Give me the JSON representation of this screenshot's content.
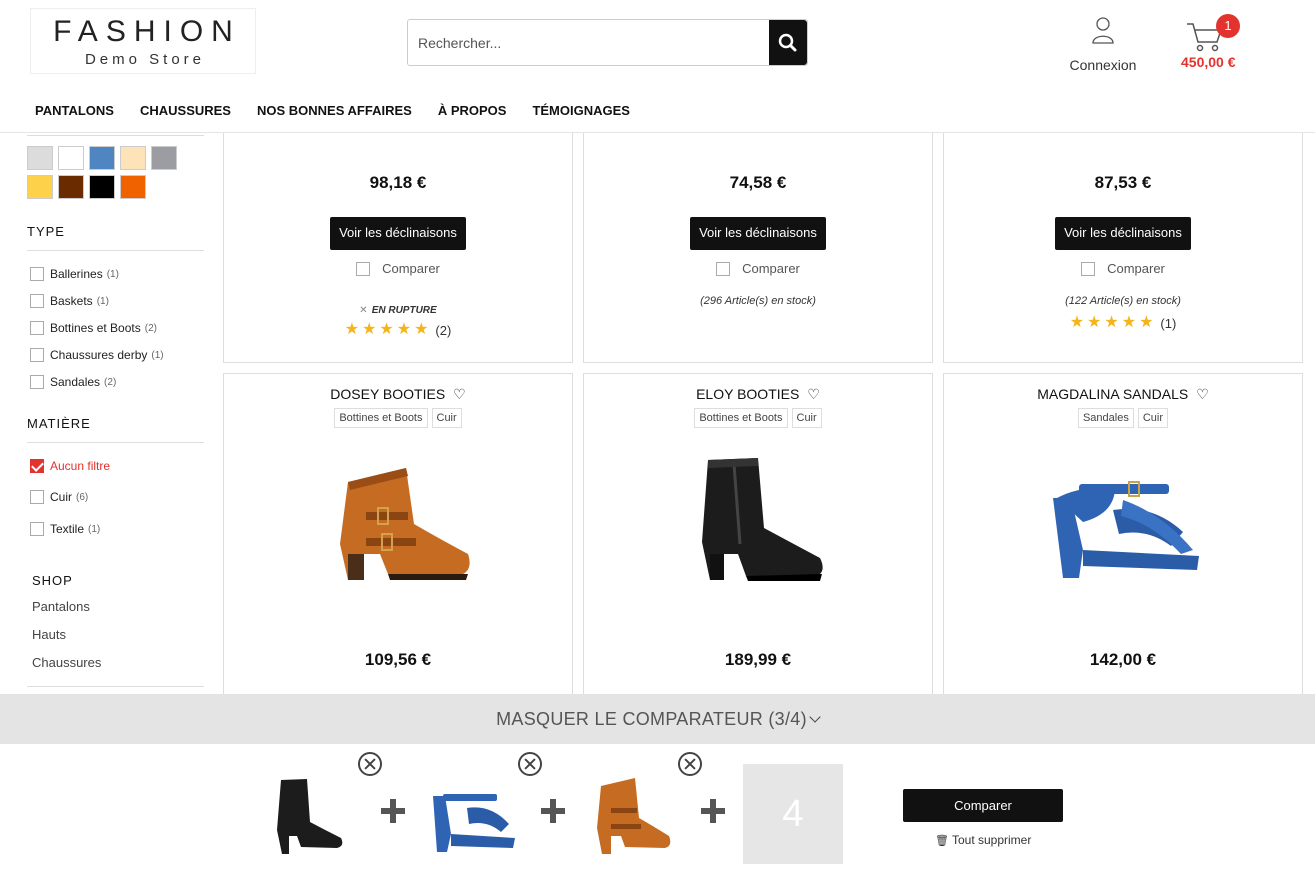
{
  "header": {
    "logo_main": "FASHION",
    "logo_sub": "Demo Store",
    "search_placeholder": "Rechercher...",
    "account_label": "Connexion",
    "cart_count": "1",
    "cart_total": "450,00 €"
  },
  "nav": [
    "PANTALONS",
    "CHAUSSURES",
    "NOS BONNES AFFAIRES",
    "À PROPOS",
    "TÉMOIGNAGES"
  ],
  "sidebar": {
    "colors": [
      "#dcdcdc",
      "#ffffff",
      "#4f86c1",
      "#fde3b7",
      "#9c9ca3",
      "#fdd14a",
      "#6b2b00",
      "#000000",
      "#f06200"
    ],
    "type_title": "TYPE",
    "types": [
      {
        "label": "Ballerines",
        "count": "(1)"
      },
      {
        "label": "Baskets",
        "count": "(1)"
      },
      {
        "label": "Bottines et Boots",
        "count": "(2)"
      },
      {
        "label": "Chaussures derby",
        "count": "(1)"
      },
      {
        "label": "Sandales",
        "count": "(2)"
      }
    ],
    "material_title": "MATIÈRE",
    "materials": [
      {
        "label": "Aucun filtre",
        "count": ""
      },
      {
        "label": "Cuir",
        "count": "(6)"
      },
      {
        "label": "Textile",
        "count": "(1)"
      }
    ],
    "shop_title": "SHOP",
    "shop_links": [
      "Pantalons",
      "Hauts",
      "Chaussures"
    ]
  },
  "products_top": [
    {
      "price": "98,18 €",
      "button": "Voir les déclinaisons",
      "compare": "Comparer",
      "stock": "EN RUPTURE",
      "reviews": "(2)",
      "rating": 5
    },
    {
      "price": "74,58 €",
      "button": "Voir les déclinaisons",
      "compare": "Comparer",
      "stock": "(296 Article(s) en stock)",
      "reviews": "",
      "rating": 0
    },
    {
      "price": "87,53 €",
      "button": "Voir les déclinaisons",
      "compare": "Comparer",
      "stock": "(122 Article(s) en stock)",
      "reviews": "(1)",
      "rating": 5
    }
  ],
  "products_bottom": [
    {
      "name": "DOSEY BOOTIES",
      "tags": [
        "Bottines et Boots",
        "Cuir"
      ],
      "price": "109,56 €",
      "image": "brown-ankle-boot"
    },
    {
      "name": "ELOY BOOTIES",
      "tags": [
        "Bottines et Boots",
        "Cuir"
      ],
      "price": "189,99 €",
      "image": "black-ankle-boot"
    },
    {
      "name": "MAGDALINA SANDALS",
      "tags": [
        "Sandales",
        "Cuir"
      ],
      "price": "142,00 €",
      "image": "blue-sandal"
    }
  ],
  "comparator": {
    "title": "MASQUER LE COMPARATEUR (3/4)",
    "empty_slot": "4",
    "compare_button": "Comparer",
    "delete_all": "Tout supprimer"
  }
}
